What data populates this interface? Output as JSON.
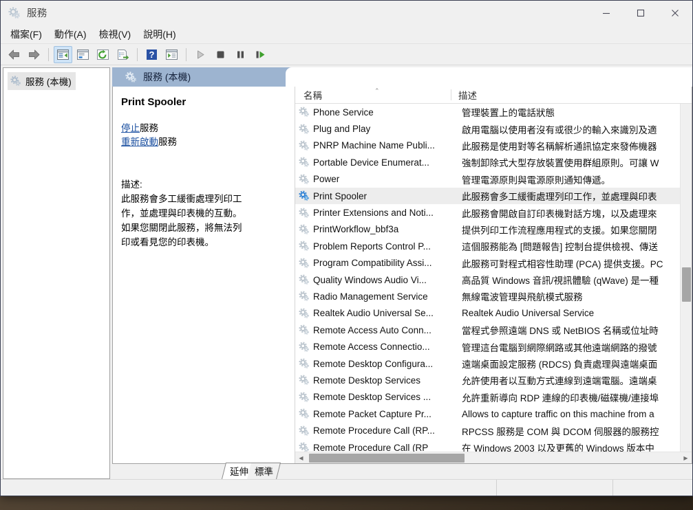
{
  "window": {
    "title": "服務",
    "icon": "services-gear-icon",
    "controls": {
      "minimize": "—",
      "maximize": "☐",
      "close": "✕"
    }
  },
  "menubar": {
    "items": [
      {
        "label": "檔案(F)",
        "name": "menu-file"
      },
      {
        "label": "動作(A)",
        "name": "menu-action"
      },
      {
        "label": "檢視(V)",
        "name": "menu-view"
      },
      {
        "label": "說明(H)",
        "name": "menu-help"
      }
    ]
  },
  "toolbar": {
    "buttons": [
      {
        "name": "back-icon",
        "glyph": "back"
      },
      {
        "name": "forward-icon",
        "glyph": "forward"
      },
      {
        "name": "show-hide-console-tree-icon",
        "glyph": "tree",
        "active": true
      },
      {
        "name": "properties-icon",
        "glyph": "properties"
      },
      {
        "name": "refresh-icon",
        "glyph": "refresh"
      },
      {
        "name": "export-list-icon",
        "glyph": "export"
      },
      {
        "name": "help-icon",
        "glyph": "help"
      },
      {
        "name": "show-action-pane-icon",
        "glyph": "actionpane"
      },
      {
        "name": "start-service-icon",
        "glyph": "play"
      },
      {
        "name": "stop-service-icon",
        "glyph": "stop"
      },
      {
        "name": "pause-service-icon",
        "glyph": "pause"
      },
      {
        "name": "restart-service-icon",
        "glyph": "restart"
      }
    ]
  },
  "tree": {
    "root": {
      "label": "服務 (本機)",
      "icon": "services-gear-icon"
    }
  },
  "console": {
    "header": {
      "label": "服務 (本機)",
      "icon": "services-gear-icon"
    }
  },
  "details": {
    "service_name": "Print Spooler",
    "links": [
      {
        "link_text": "停止",
        "suffix": "服務",
        "name": "stop-service-link"
      },
      {
        "link_text": "重新啟動",
        "suffix": "服務",
        "name": "restart-service-link"
      }
    ],
    "description_label": "描述:",
    "description_text": "此服務會多工緩衝處理列印工作，並處理與印表機的互動。如果您關閉此服務，將無法列印或看見您的印表機。"
  },
  "list": {
    "columns": [
      {
        "label": "名稱",
        "name": "column-header-name",
        "sort": "asc",
        "sort_caret": "⌃"
      },
      {
        "label": "描述",
        "name": "column-header-description"
      }
    ],
    "rows": [
      {
        "name": "Phone Service",
        "desc": "管理裝置上的電話狀態",
        "selected": false
      },
      {
        "name": "Plug and Play",
        "desc": "啟用電腦以使用者沒有或很少的輸入來識別及適",
        "selected": false
      },
      {
        "name": "PNRP Machine Name Publi...",
        "desc": "此服務是使用對等名稱解析通訊協定來發佈機器",
        "selected": false
      },
      {
        "name": "Portable Device Enumerat...",
        "desc": "強制卸除式大型存放裝置使用群組原則。可讓 W",
        "selected": false
      },
      {
        "name": "Power",
        "desc": "管理電源原則與電源原則通知傳遞。",
        "selected": false
      },
      {
        "name": "Print Spooler",
        "desc": "此服務會多工緩衝處理列印工作，並處理與印表",
        "selected": true
      },
      {
        "name": "Printer Extensions and Noti...",
        "desc": "此服務會開啟自訂印表機對話方塊，以及處理來",
        "selected": false
      },
      {
        "name": "PrintWorkflow_bbf3a",
        "desc": "提供列印工作流程應用程式的支援。如果您關閉",
        "selected": false
      },
      {
        "name": "Problem Reports Control P...",
        "desc": "這個服務能為 [問題報告] 控制台提供檢視、傳送",
        "selected": false
      },
      {
        "name": "Program Compatibility Assi...",
        "desc": "此服務可對程式相容性助理 (PCA) 提供支援。PC",
        "selected": false
      },
      {
        "name": "Quality Windows Audio Vi...",
        "desc": "高品質 Windows 音訊/視訊體驗 (qWave) 是一種",
        "selected": false
      },
      {
        "name": "Radio Management Service",
        "desc": "無線電波管理與飛航模式服務",
        "selected": false
      },
      {
        "name": "Realtek Audio Universal Se...",
        "desc": "Realtek Audio Universal Service",
        "selected": false
      },
      {
        "name": "Remote Access Auto Conn...",
        "desc": "當程式參照遠端 DNS 或 NetBIOS 名稱或位址時",
        "selected": false
      },
      {
        "name": "Remote Access Connectio...",
        "desc": "管理這台電腦到網際網路或其他遠端網路的撥號",
        "selected": false
      },
      {
        "name": "Remote Desktop Configura...",
        "desc": "遠端桌面設定服務 (RDCS) 負責處理與遠端桌面",
        "selected": false
      },
      {
        "name": "Remote Desktop Services",
        "desc": "允許使用者以互動方式連線到遠端電腦。遠端桌",
        "selected": false
      },
      {
        "name": "Remote Desktop Services ...",
        "desc": "允許重新導向 RDP 連線的印表機/磁碟機/連接埠",
        "selected": false
      },
      {
        "name": "Remote Packet Capture Pr...",
        "desc": "Allows to capture traffic on this machine from a",
        "selected": false
      },
      {
        "name": "Remote Procedure Call (RP...",
        "desc": "RPCSS 服務是 COM 與 DCOM 伺服器的服務控",
        "selected": false
      },
      {
        "name": "Remote Procedure Call (RP",
        "desc": "在 Windows 2003 以及更舊的 Windows 版本中",
        "selected": false
      }
    ],
    "scroll": {
      "vertical_thumb_top_pct": 47,
      "vertical_thumb_height_pct": 10,
      "horizontal_left_arrow": "◀",
      "horizontal_right_arrow": "▶"
    }
  },
  "tabs": [
    {
      "label": "延伸",
      "name": "tab-extended",
      "selected": true
    },
    {
      "label": "標準",
      "name": "tab-standard",
      "selected": false
    }
  ],
  "colors": {
    "console_header_blue": "#9db4d0",
    "selection_grey": "#ededed",
    "link_blue": "#1a4fa0",
    "window_chrome": "#f0f0f0",
    "service_icon_blue": "#2a7fd4",
    "service_icon_grey": "#b9c3cc"
  }
}
